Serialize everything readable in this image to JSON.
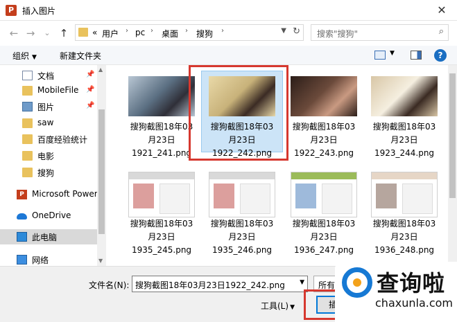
{
  "window": {
    "title": "插入图片",
    "app_icon_letter": "P",
    "close_glyph": "✕"
  },
  "nav": {
    "back_glyph": "←",
    "forward_glyph": "→",
    "recent_glyph": "⌄",
    "up_glyph": "↑",
    "breadcrumb": [
      "«",
      "用户",
      "pc",
      "桌面",
      "搜狗"
    ],
    "crumb_sep": "›",
    "refresh_glyph": "↻",
    "search_placeholder": "搜索\"搜狗\"",
    "search_glyph": "⌕"
  },
  "toolbar": {
    "organize": "组织",
    "new_folder": "新建文件夹",
    "caret": "▼",
    "help": "?"
  },
  "sidebar": {
    "items": [
      {
        "label": "文档",
        "icon": "document-icon",
        "pinned": true
      },
      {
        "label": "MobileFile",
        "icon": "folder-icon",
        "pinned": true
      },
      {
        "label": "图片",
        "icon": "picture-icon",
        "pinned": true
      },
      {
        "label": "saw",
        "icon": "folder-icon",
        "pinned": false
      },
      {
        "label": "百度经验统计",
        "icon": "folder-icon",
        "pinned": false
      },
      {
        "label": "电影",
        "icon": "folder-icon",
        "pinned": false
      },
      {
        "label": "搜狗",
        "icon": "folder-icon",
        "pinned": false
      },
      {
        "label": "Microsoft Power",
        "icon": "powerpoint-icon",
        "pinned": false
      },
      {
        "label": "OneDrive",
        "icon": "onedrive-icon",
        "pinned": false
      },
      {
        "label": "此电脑",
        "icon": "computer-icon",
        "pinned": false,
        "selected": true
      },
      {
        "label": "网络",
        "icon": "network-icon",
        "pinned": false
      }
    ],
    "pin_glyph": "📌"
  },
  "files": [
    {
      "line1": "搜狗截图18年03",
      "line2": "月23日",
      "line3": "1921_241.png",
      "kind": "photo",
      "colors": [
        "#5b6f82",
        "#2f2f38",
        "#b9c7d4"
      ]
    },
    {
      "line1": "搜狗截图18年03",
      "line2": "月23日",
      "line3": "1922_242.png",
      "kind": "photo",
      "selected": true,
      "colors": [
        "#c8b27a",
        "#3b2b24",
        "#e9d9a8"
      ]
    },
    {
      "line1": "搜狗截图18年03",
      "line2": "月23日",
      "line3": "1922_243.png",
      "kind": "photo",
      "colors": [
        "#6b4a3b",
        "#c99a82",
        "#2b1d18"
      ]
    },
    {
      "line1": "搜狗截图18年03",
      "line2": "月23日",
      "line3": "1923_244.png",
      "kind": "photo",
      "colors": [
        "#f5efe0",
        "#3a2a22",
        "#d8c6a6"
      ]
    },
    {
      "line1": "搜狗截图18年03",
      "line2": "月23日",
      "line3": "1935_245.png",
      "kind": "screen",
      "colors": [
        "#ffffff",
        "#c0504d",
        "#d9d9d9"
      ]
    },
    {
      "line1": "搜狗截图18年03",
      "line2": "月23日",
      "line3": "1935_246.png",
      "kind": "screen",
      "colors": [
        "#ffffff",
        "#c0504d",
        "#d9d9d9"
      ]
    },
    {
      "line1": "搜狗截图18年03",
      "line2": "月23日",
      "line3": "1936_247.png",
      "kind": "screen",
      "colors": [
        "#ffffff",
        "#4f81bd",
        "#9bbb59"
      ]
    },
    {
      "line1": "搜狗截图18年03",
      "line2": "月23日",
      "line3": "1936_248.png",
      "kind": "screen",
      "colors": [
        "#ffffff",
        "#7a5c4f",
        "#e6d6c6"
      ]
    }
  ],
  "footer": {
    "filename_label": "文件名(N):",
    "filename_value": "搜狗截图18年03月23日1922_242.png",
    "filetype_value": "所有",
    "tools_label": "工具(L)",
    "insert_label": "插入",
    "dropdown_caret": "▼"
  },
  "watermark": {
    "title": "查询啦",
    "url": "chaxunla.com"
  },
  "colors": {
    "highlight_red": "#d6382f",
    "selection_blue": "#cce4f7",
    "accent_blue": "#0078d7"
  }
}
